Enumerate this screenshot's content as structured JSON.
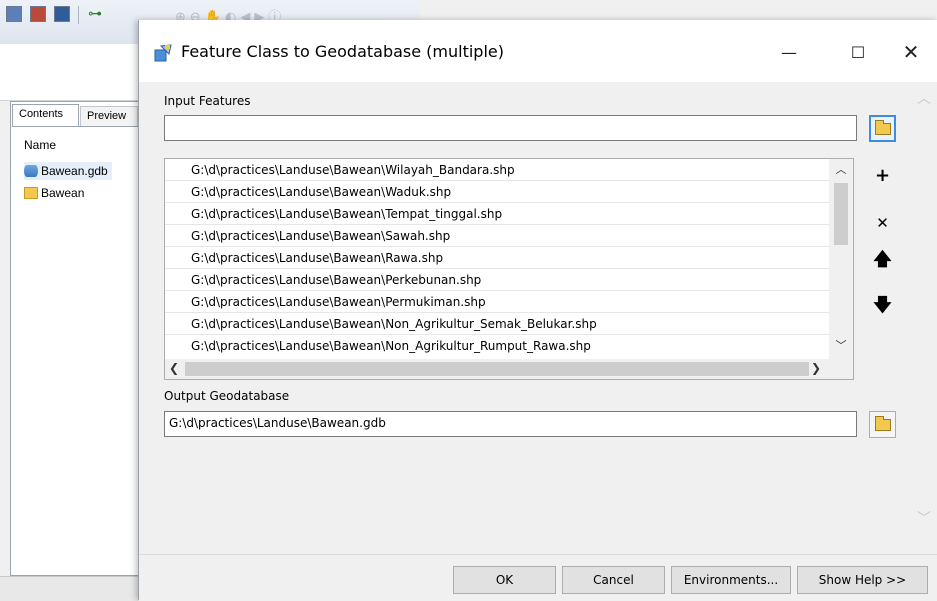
{
  "catalog": {
    "tabs": [
      "Contents",
      "Preview"
    ],
    "name_header": "Name",
    "items": [
      {
        "label": "Bawean.gdb",
        "icon": "geodatabase-icon"
      },
      {
        "label": "Bawean",
        "icon": "folder-icon"
      }
    ]
  },
  "dialog": {
    "title": "Feature Class to Geodatabase (multiple)",
    "window_controls": {
      "minimize": "—",
      "maximize": "☐",
      "close": "✕"
    },
    "input_label": "Input Features",
    "input_value": "",
    "input_files": [
      "G:\\d\\practices\\Landuse\\Bawean\\Wilayah_Bandara.shp",
      "G:\\d\\practices\\Landuse\\Bawean\\Waduk.shp",
      "G:\\d\\practices\\Landuse\\Bawean\\Tempat_tinggal.shp",
      "G:\\d\\practices\\Landuse\\Bawean\\Sawah.shp",
      "G:\\d\\practices\\Landuse\\Bawean\\Rawa.shp",
      "G:\\d\\practices\\Landuse\\Bawean\\Perkebunan.shp",
      "G:\\d\\practices\\Landuse\\Bawean\\Permukiman.shp",
      "G:\\d\\practices\\Landuse\\Bawean\\Non_Agrikultur_Semak_Belukar.shp",
      "G:\\d\\practices\\Landuse\\Bawean\\Non_Agrikultur_Rumput_Rawa.shp"
    ],
    "list_buttons": {
      "add": "+",
      "remove": "✕",
      "up": "🡅",
      "down": "🡇"
    },
    "output_label": "Output Geodatabase",
    "output_value": "G:\\d\\practices\\Landuse\\Bawean.gdb",
    "buttons": {
      "ok": "OK",
      "cancel": "Cancel",
      "environments": "Environments...",
      "help": "Show Help >>"
    }
  },
  "colors": {
    "accent": "#3c8de0",
    "folder": "#f2c94c"
  }
}
